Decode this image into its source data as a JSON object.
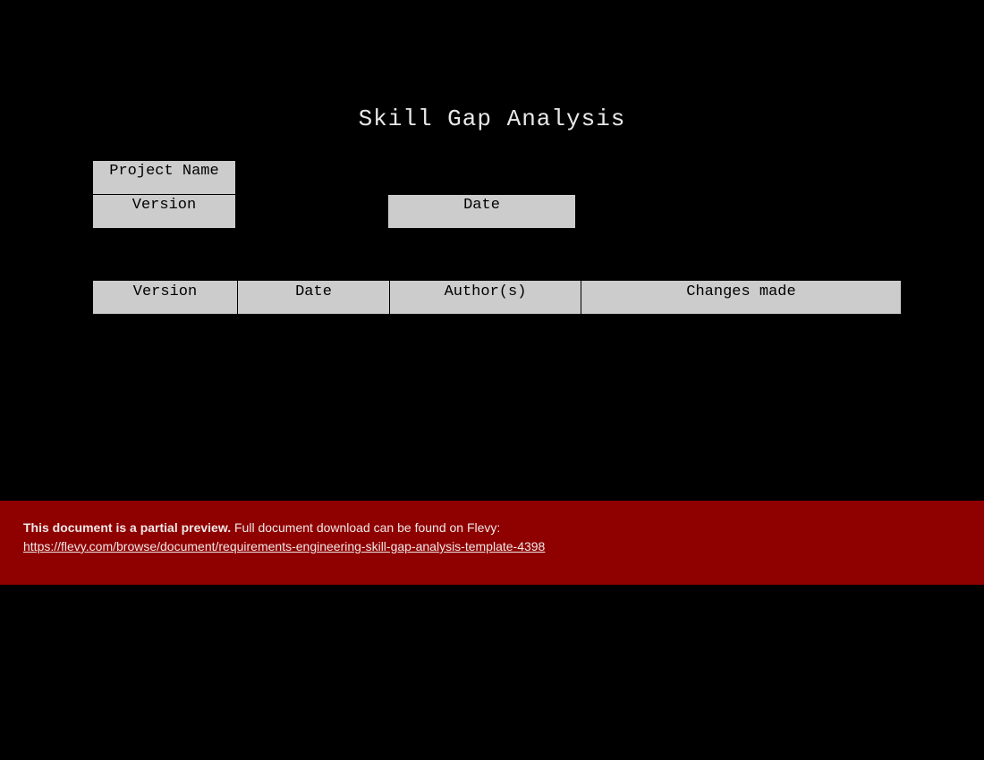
{
  "title": "Skill Gap Analysis",
  "meta": {
    "project_name_label": "Project Name",
    "version_label": "Version",
    "date_label": "Date",
    "project_name_value": "",
    "version_value": "",
    "date_value": ""
  },
  "history": {
    "headers": {
      "version": "Version",
      "date": "Date",
      "author": "Author(s)",
      "changes": "Changes made"
    },
    "rows": []
  },
  "banner": {
    "bold_text": "This document is a partial preview.",
    "rest_text": "  Full document download can be found on Flevy:",
    "link_text": "https://flevy.com/browse/document/requirements-engineering-skill-gap-analysis-template-4398",
    "link_href": "https://flevy.com/browse/document/requirements-engineering-skill-gap-analysis-template-4398"
  },
  "colors": {
    "background": "#000000",
    "cell_bg": "#cccccc",
    "banner_bg": "#8f0000"
  }
}
